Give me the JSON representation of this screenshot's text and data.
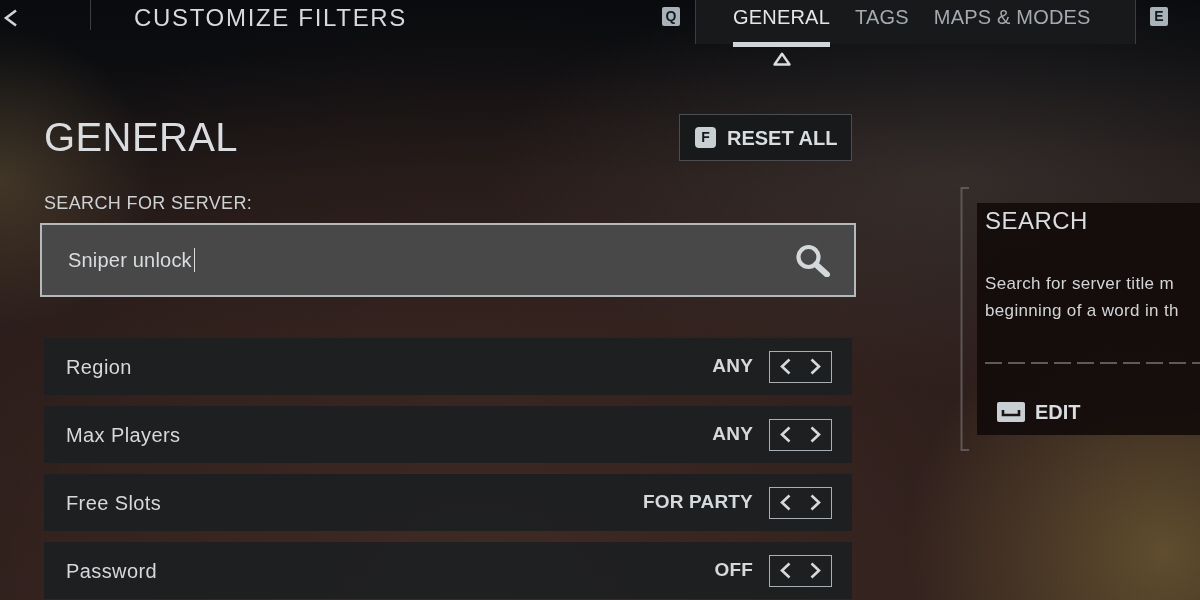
{
  "header": {
    "title": "CUSTOMIZE FILTERS",
    "prev_key": "Q",
    "next_key": "E"
  },
  "tabs": [
    {
      "label": "GENERAL",
      "selected": true
    },
    {
      "label": "TAGS",
      "selected": false
    },
    {
      "label": "MAPS & MODES",
      "selected": false
    }
  ],
  "section": {
    "title": "GENERAL",
    "reset_button": {
      "key": "F",
      "label": "RESET ALL"
    }
  },
  "search": {
    "label": "SEARCH FOR SERVER:",
    "value": "Sniper unlock",
    "focused": true
  },
  "filters": [
    {
      "label": "Region",
      "value": "ANY"
    },
    {
      "label": "Max Players",
      "value": "ANY"
    },
    {
      "label": "Free Slots",
      "value": "FOR PARTY"
    },
    {
      "label": "Password",
      "value": "OFF"
    }
  ],
  "help_panel": {
    "title": "SEARCH",
    "description": [
      "Search for server title m",
      "beginning of a word in th"
    ],
    "action": "EDIT"
  }
}
